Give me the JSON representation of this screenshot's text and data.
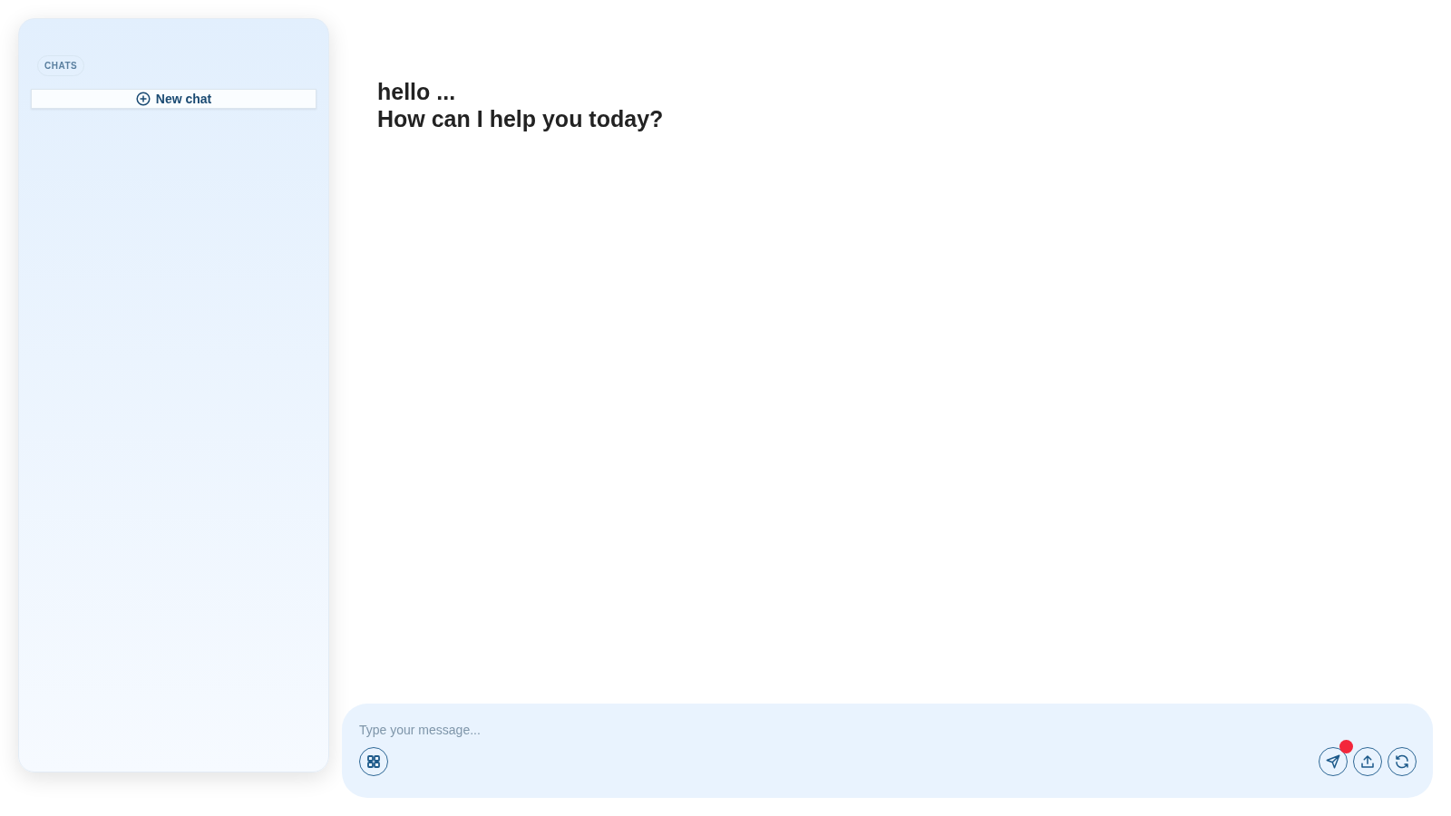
{
  "sidebar": {
    "section_label": "CHATS",
    "new_chat": {
      "label": "New chat"
    }
  },
  "greeting": [
    "hello ...",
    "How can I help you today?"
  ],
  "composer": {
    "placeholder": "Type your message...",
    "left_actions": [
      {
        "kind": "grid"
      }
    ],
    "right_actions": [
      {
        "kind": "send",
        "badge": true
      },
      {
        "kind": "upload",
        "badge": false
      },
      {
        "kind": "refresh",
        "badge": false
      }
    ]
  }
}
